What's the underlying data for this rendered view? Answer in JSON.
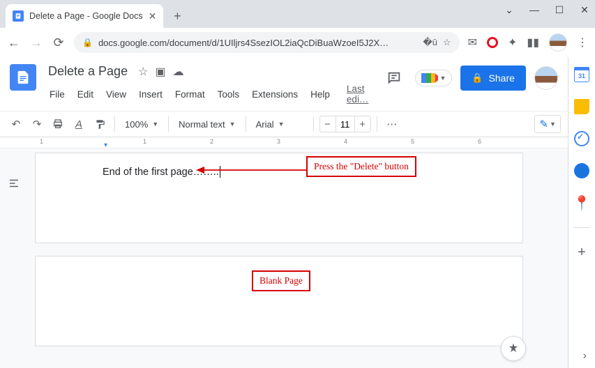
{
  "browser": {
    "tab_title": "Delete a Page - Google Docs",
    "url": "docs.google.com/document/d/1UIljrs4SsezIOL2iaQcDiBuaWzoeI5J2X…"
  },
  "doc": {
    "title": "Delete a Page",
    "last_edit": "Last edi…"
  },
  "menu": {
    "file": "File",
    "edit": "Edit",
    "view": "View",
    "insert": "Insert",
    "format": "Format",
    "tools": "Tools",
    "extensions": "Extensions",
    "help": "Help"
  },
  "toolbar": {
    "zoom": "100%",
    "style": "Normal text",
    "font": "Arial",
    "font_size": "11"
  },
  "share": {
    "label": "Share"
  },
  "content": {
    "page1_text": "End of the first page……..",
    "anno1": "Press the \"Delete\" button",
    "anno2": "Blank Page"
  },
  "ruler": {
    "marks": [
      "1",
      "1",
      "2",
      "3",
      "4",
      "5",
      "6"
    ]
  },
  "calendar_day": "31"
}
